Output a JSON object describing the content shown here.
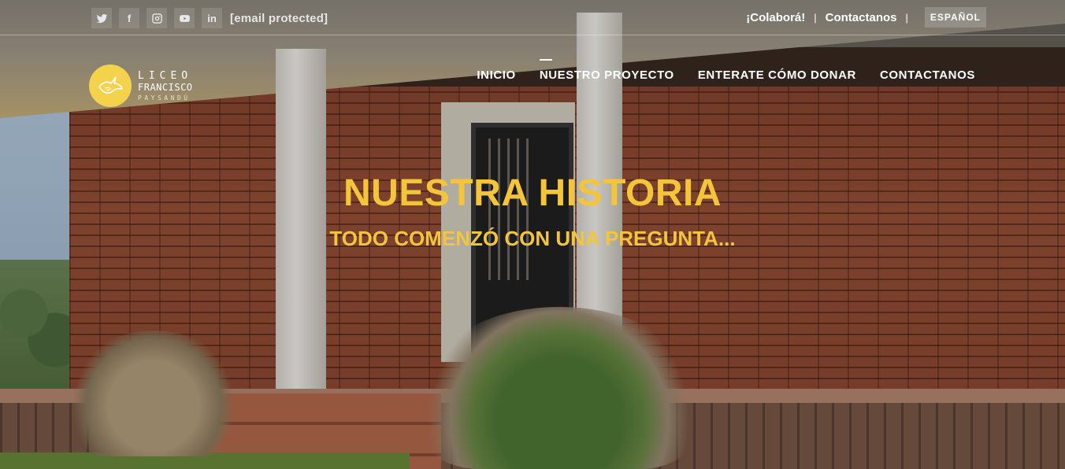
{
  "topbar": {
    "social": [
      {
        "icon": "twitter-icon",
        "glyph": ""
      },
      {
        "icon": "facebook-icon",
        "glyph": "f"
      },
      {
        "icon": "instagram-icon",
        "glyph": ""
      },
      {
        "icon": "youtube-icon",
        "glyph": ""
      },
      {
        "icon": "linkedin-icon",
        "glyph": "in"
      }
    ],
    "email": "[email protected]",
    "links": [
      "¡Colaborá!",
      "Contactanos"
    ],
    "language": "ESPAÑOL"
  },
  "logo": {
    "line1": "LICEO",
    "line2": "FRANCISCO",
    "line3": "PAYSANDÚ"
  },
  "nav": {
    "items": [
      "INICIO",
      "NUESTRO PROYECTO",
      "ENTERATE CÓMO DONAR",
      "CONTACTANOS"
    ],
    "active": "NUESTRO PROYECTO"
  },
  "hero": {
    "title": "NUESTRA HISTORIA",
    "subtitle": "TODO COMENZÓ CON UNA PREGUNTA..."
  },
  "colors": {
    "accent": "#f4c53a",
    "logo_circle": "#f4d24b"
  }
}
